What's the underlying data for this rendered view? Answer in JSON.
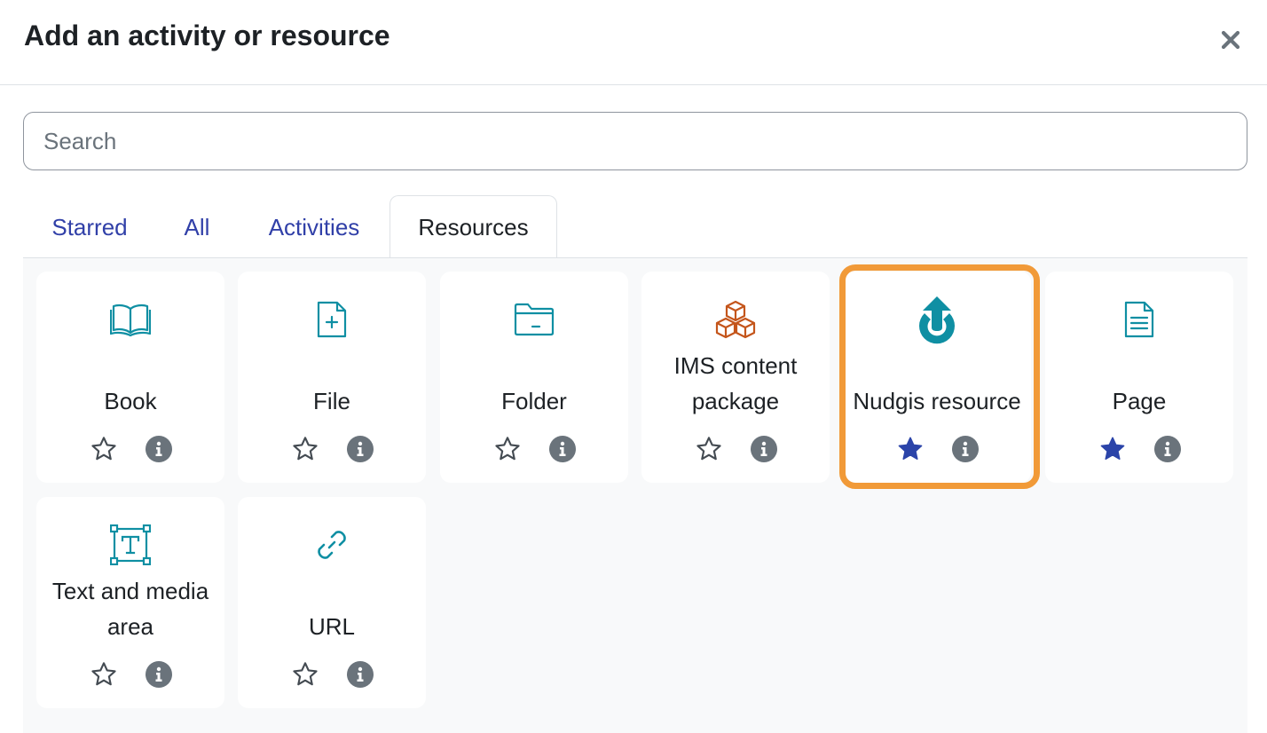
{
  "modal": {
    "title": "Add an activity or resource",
    "close_icon": "close-icon"
  },
  "search": {
    "placeholder": "Search",
    "value": ""
  },
  "tabs": [
    {
      "label": "Starred",
      "active": false
    },
    {
      "label": "All",
      "active": false
    },
    {
      "label": "Activities",
      "active": false
    },
    {
      "label": "Resources",
      "active": true
    }
  ],
  "items": [
    {
      "label": "Book",
      "icon": "book-icon",
      "starred": false
    },
    {
      "label": "File",
      "icon": "file-add-icon",
      "starred": false
    },
    {
      "label": "Folder",
      "icon": "folder-icon",
      "starred": false
    },
    {
      "label": "IMS content package",
      "icon": "cubes-icon",
      "starred": false
    },
    {
      "label": "Nudgis resource",
      "icon": "nudgis-upload-icon",
      "starred": true,
      "highlighted": true
    },
    {
      "label": "Page",
      "icon": "page-icon",
      "starred": true
    },
    {
      "label": "Text and media area",
      "icon": "text-frame-icon",
      "starred": false
    },
    {
      "label": "URL",
      "icon": "link-icon",
      "starred": false
    }
  ],
  "colors": {
    "accent": "#3140a8",
    "icon_teal": "#0f8fa3",
    "icon_orange": "#c4551b",
    "star_filled": "#2b44a9",
    "star_outline": "#444b52",
    "info": "#6a737b",
    "highlight": "#f19a38",
    "content_bg": "#f8f9fa"
  }
}
